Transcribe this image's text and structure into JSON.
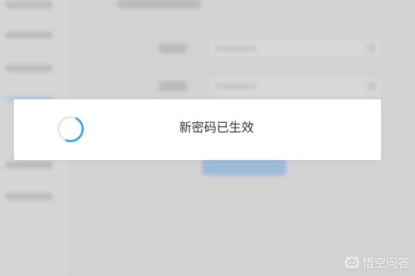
{
  "toast": {
    "message": "新密码已生效",
    "status": "loading"
  },
  "watermark": {
    "text": "悟空问答",
    "icon": "wukong-logo-icon"
  },
  "colors": {
    "overlay_background": "#d2d2d2",
    "toast_background": "#ffffff",
    "spinner_accent": "#3a9ee8",
    "spinner_track": "#e6e6e6",
    "submit_button": "#74a6dc",
    "message_text": "#333333"
  }
}
